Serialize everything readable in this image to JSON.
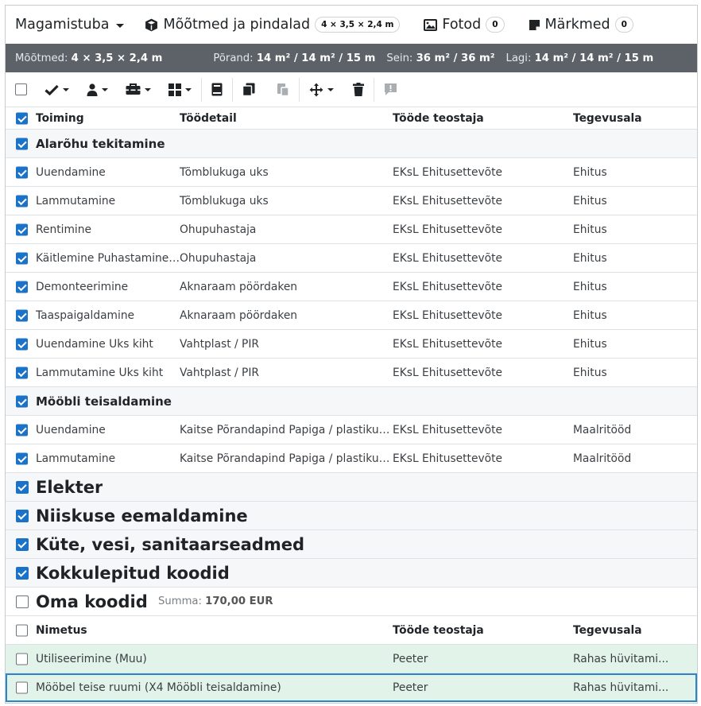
{
  "topbar": {
    "room": "Magamistuba",
    "dims_label": "Mõõtmed ja pindalad",
    "dims_badge": "4 × 3,5 × 2,4 m",
    "photos_label": "Fotod",
    "photos_count": "0",
    "notes_label": "Märkmed",
    "notes_count": "0"
  },
  "info": {
    "dims_label": "Mõõtmed:",
    "dims_value": "4 × 3,5 × 2,4 m",
    "floor_label": "Põrand:",
    "floor_value": "14 m² / 14 m² / 15 m",
    "wall_label": "Sein:",
    "wall_value": "36 m² / 36 m²",
    "ceiling_label": "Lagi:",
    "ceiling_value": "14 m² / 14 m² / 15 m"
  },
  "icons": [
    "check-icon",
    "person-icon",
    "toolbox-icon",
    "grid-icon",
    "book-icon",
    "copy-icon",
    "paste-icon",
    "move-icon",
    "trash-icon",
    "comment-alert-icon"
  ],
  "colors": {
    "accent": "#1a73c8",
    "info_bar": "#5c6268",
    "row_green": "#e2f3ea"
  },
  "table": {
    "headers": [
      "Toiming",
      "Töödetail",
      "Tööde teostaja",
      "Tegevusala"
    ],
    "group1": "Alarõhu tekitamine",
    "rows1": [
      {
        "action": "Uuendamine",
        "detail": "Tõmblukuga uks",
        "contractor": "EKsL Ehitusettevõte",
        "area": "Ehitus"
      },
      {
        "action": "Lammutamine",
        "detail": "Tõmblukuga uks",
        "contractor": "EKsL Ehitusettevõte",
        "area": "Ehitus"
      },
      {
        "action": "Rentimine",
        "detail": "Õhupuhastaja",
        "contractor": "EKsL Ehitusettevõte",
        "area": "Ehitus"
      },
      {
        "action": "Käitlemine Puhastamine j...",
        "detail": "Õhupuhastaja",
        "contractor": "EKsL Ehitusettevõte",
        "area": "Ehitus"
      },
      {
        "action": "Demonteerimine",
        "detail": "Aknaraam pöördaken",
        "contractor": "EKsL Ehitusettevõte",
        "area": "Ehitus"
      },
      {
        "action": "Taaspaigaldamine",
        "detail": "Aknaraam pöördaken",
        "contractor": "EKsL Ehitusettevõte",
        "area": "Ehitus"
      },
      {
        "action": "Uuendamine Üks kiht",
        "detail": "Vahtplast / PIR",
        "contractor": "EKsL Ehitusettevõte",
        "area": "Ehitus"
      },
      {
        "action": "Lammutamine Üks kiht",
        "detail": "Vahtplast / PIR",
        "contractor": "EKsL Ehitusettevõte",
        "area": "Ehitus"
      }
    ],
    "group2": "Mööbli teisaldamine",
    "rows2": [
      {
        "action": "Uuendamine",
        "detail": "Kaitse Põrandapind Papiga / plastikug...",
        "contractor": "EKsL Ehitusettevõte",
        "area": "Maalritööd"
      },
      {
        "action": "Lammutamine",
        "detail": "Kaitse Põrandapind Papiga / plastikug...",
        "contractor": "EKsL Ehitusettevõte",
        "area": "Maalritööd"
      }
    ],
    "big_groups": [
      "Elekter",
      "Niiskuse eemaldamine",
      "Küte, vesi, sanitaarseadmed",
      "Kokkulepitud koodid"
    ]
  },
  "custom": {
    "title": "Oma koodid",
    "sum_label": "Summa:",
    "sum_value": "170,00 EUR",
    "headers": [
      "Nimetus",
      "Tööde teostaja",
      "Tegevusala"
    ],
    "rows": [
      {
        "name": "Utiliseerimine (Muu)",
        "contractor": "Peeter",
        "area": "Rahas hüvitami..."
      },
      {
        "name": "Mööbel teise ruumi (X4 Mööbli teisaldamine)",
        "contractor": "Peeter",
        "area": "Rahas hüvitami..."
      }
    ]
  }
}
